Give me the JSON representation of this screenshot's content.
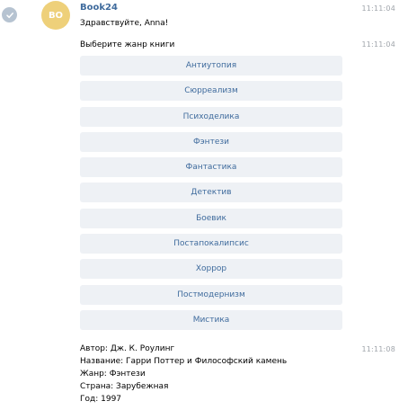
{
  "colors": {
    "avatar_bg": "#eed07a",
    "sender_name": "#3f6b9d",
    "button_text": "#3f6b9d",
    "button_bg": "#eef1f5",
    "time": "#a0a5ab",
    "read_check_bg": "#b6c3d1"
  },
  "status": {
    "icon": "check-icon"
  },
  "bot": {
    "initials": "BO",
    "name": "Book24"
  },
  "messages": [
    {
      "text": "Здравствуйте, Anna!",
      "time": "11:11:04"
    },
    {
      "text": "Выберите жанр книги",
      "time": "11:11:04"
    }
  ],
  "genre_buttons": [
    "Антиутопия",
    "Сюрреализм",
    "Психоделика",
    "Фэнтези",
    "Фантастика",
    "Детектив",
    "Боевик",
    "Постапокалипсис",
    "Хоррор",
    "Постмодернизм",
    "Мистика"
  ],
  "result": {
    "time": "11:11:08",
    "lines": [
      "Автор: Дж. К. Роулинг",
      "Название: Гарри Поттер и Философский камень",
      "Жанр: Фэнтези",
      "Страна: Зарубежная",
      "Год: 1997"
    ]
  }
}
